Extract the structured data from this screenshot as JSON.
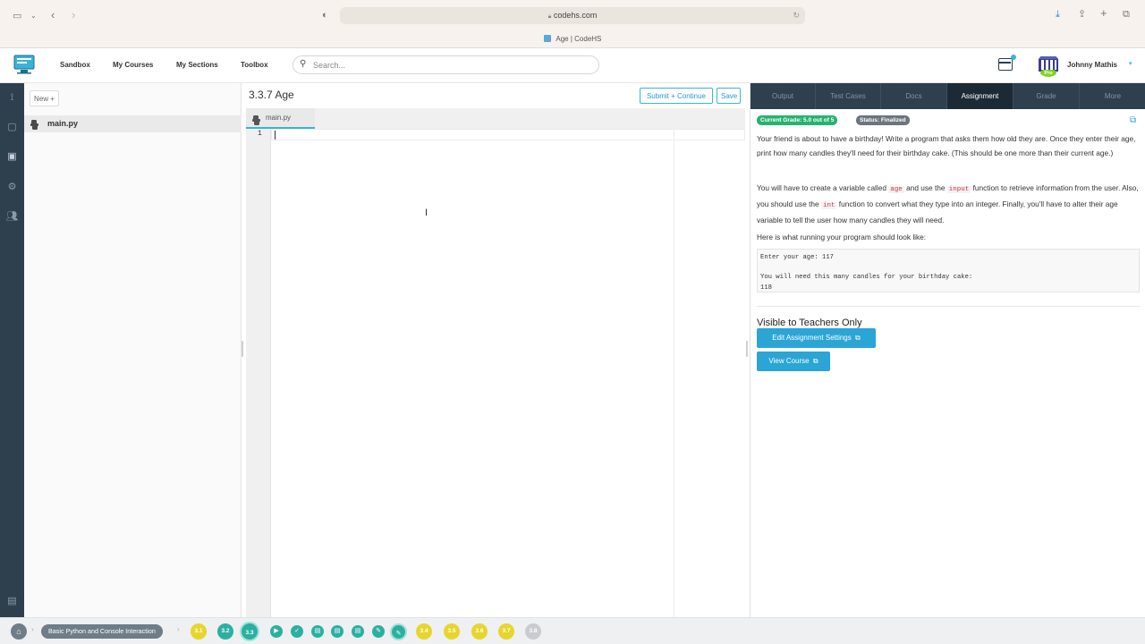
{
  "browser": {
    "url": "codehs.com",
    "tab_title": "Age | CodeHS"
  },
  "header": {
    "nav": [
      "Sandbox",
      "My Courses",
      "My Sections",
      "Toolbox"
    ],
    "search_placeholder": "Search...",
    "user_name": "Johnny Mathis",
    "pro_badge": "Pro"
  },
  "file_panel": {
    "new_label": "New +",
    "files": [
      "main.py"
    ]
  },
  "editor": {
    "title": "3.3.7 Age",
    "submit_label": "Submit + Continue",
    "save_label": "Save",
    "tab": "main.py",
    "line_number": "1"
  },
  "right_panel": {
    "tabs": [
      "Output",
      "Test Cases",
      "Docs",
      "Assignment",
      "Grade",
      "More"
    ],
    "active_tab": "Assignment",
    "grade_badge": "Current Grade: 5.0 out of 5",
    "status_badge": "Status: Finalized",
    "p1": "Your friend is about to have a birthday! Write a program that asks them how old they are. Once they enter their age, print how many candles they'll need for their birthday cake. (This should be one more than their current age.)",
    "p2": {
      "a": "You will have to create a variable called ",
      "code1": "age",
      "b": " and use the ",
      "code2": "input",
      "c": " function to retrieve information from the user. Also, you should use the ",
      "code3": "int",
      "d": " function to convert what they type into an integer. Finally, you'll have to alter their age variable to tell the user how many candles they will need."
    },
    "p3": "Here is what running your program should look like:",
    "sample": {
      "line1": "Enter your age: 117",
      "line2": "You will need this many candles for your birthday cake:",
      "line3": "118"
    },
    "teachers_title": "Visible to Teachers Only",
    "edit_settings_label": "Edit Assignment Settings",
    "view_course_label": "View Course"
  },
  "bottom_bar": {
    "crumb": "Basic Python and Console Interaction",
    "lessons_left": [
      {
        "label": "3.1",
        "color": "#e8d52b"
      },
      {
        "label": "3.2",
        "color": "#2bb0a0"
      },
      {
        "label": "3.3",
        "color": "#2bb0a0"
      }
    ],
    "lessons_right": [
      {
        "label": "3.4",
        "color": "#e8d52b"
      },
      {
        "label": "3.5",
        "color": "#e8d52b"
      },
      {
        "label": "3.6",
        "color": "#e8d52b"
      },
      {
        "label": "3.7",
        "color": "#e8d52b"
      },
      {
        "label": "3.8",
        "color": "#c8ccd0"
      }
    ]
  },
  "colors": {
    "accent": "#2ba5d6",
    "rail": "#2e3f4e",
    "green_badge": "#26b36f",
    "gray_badge": "#6c757d"
  }
}
